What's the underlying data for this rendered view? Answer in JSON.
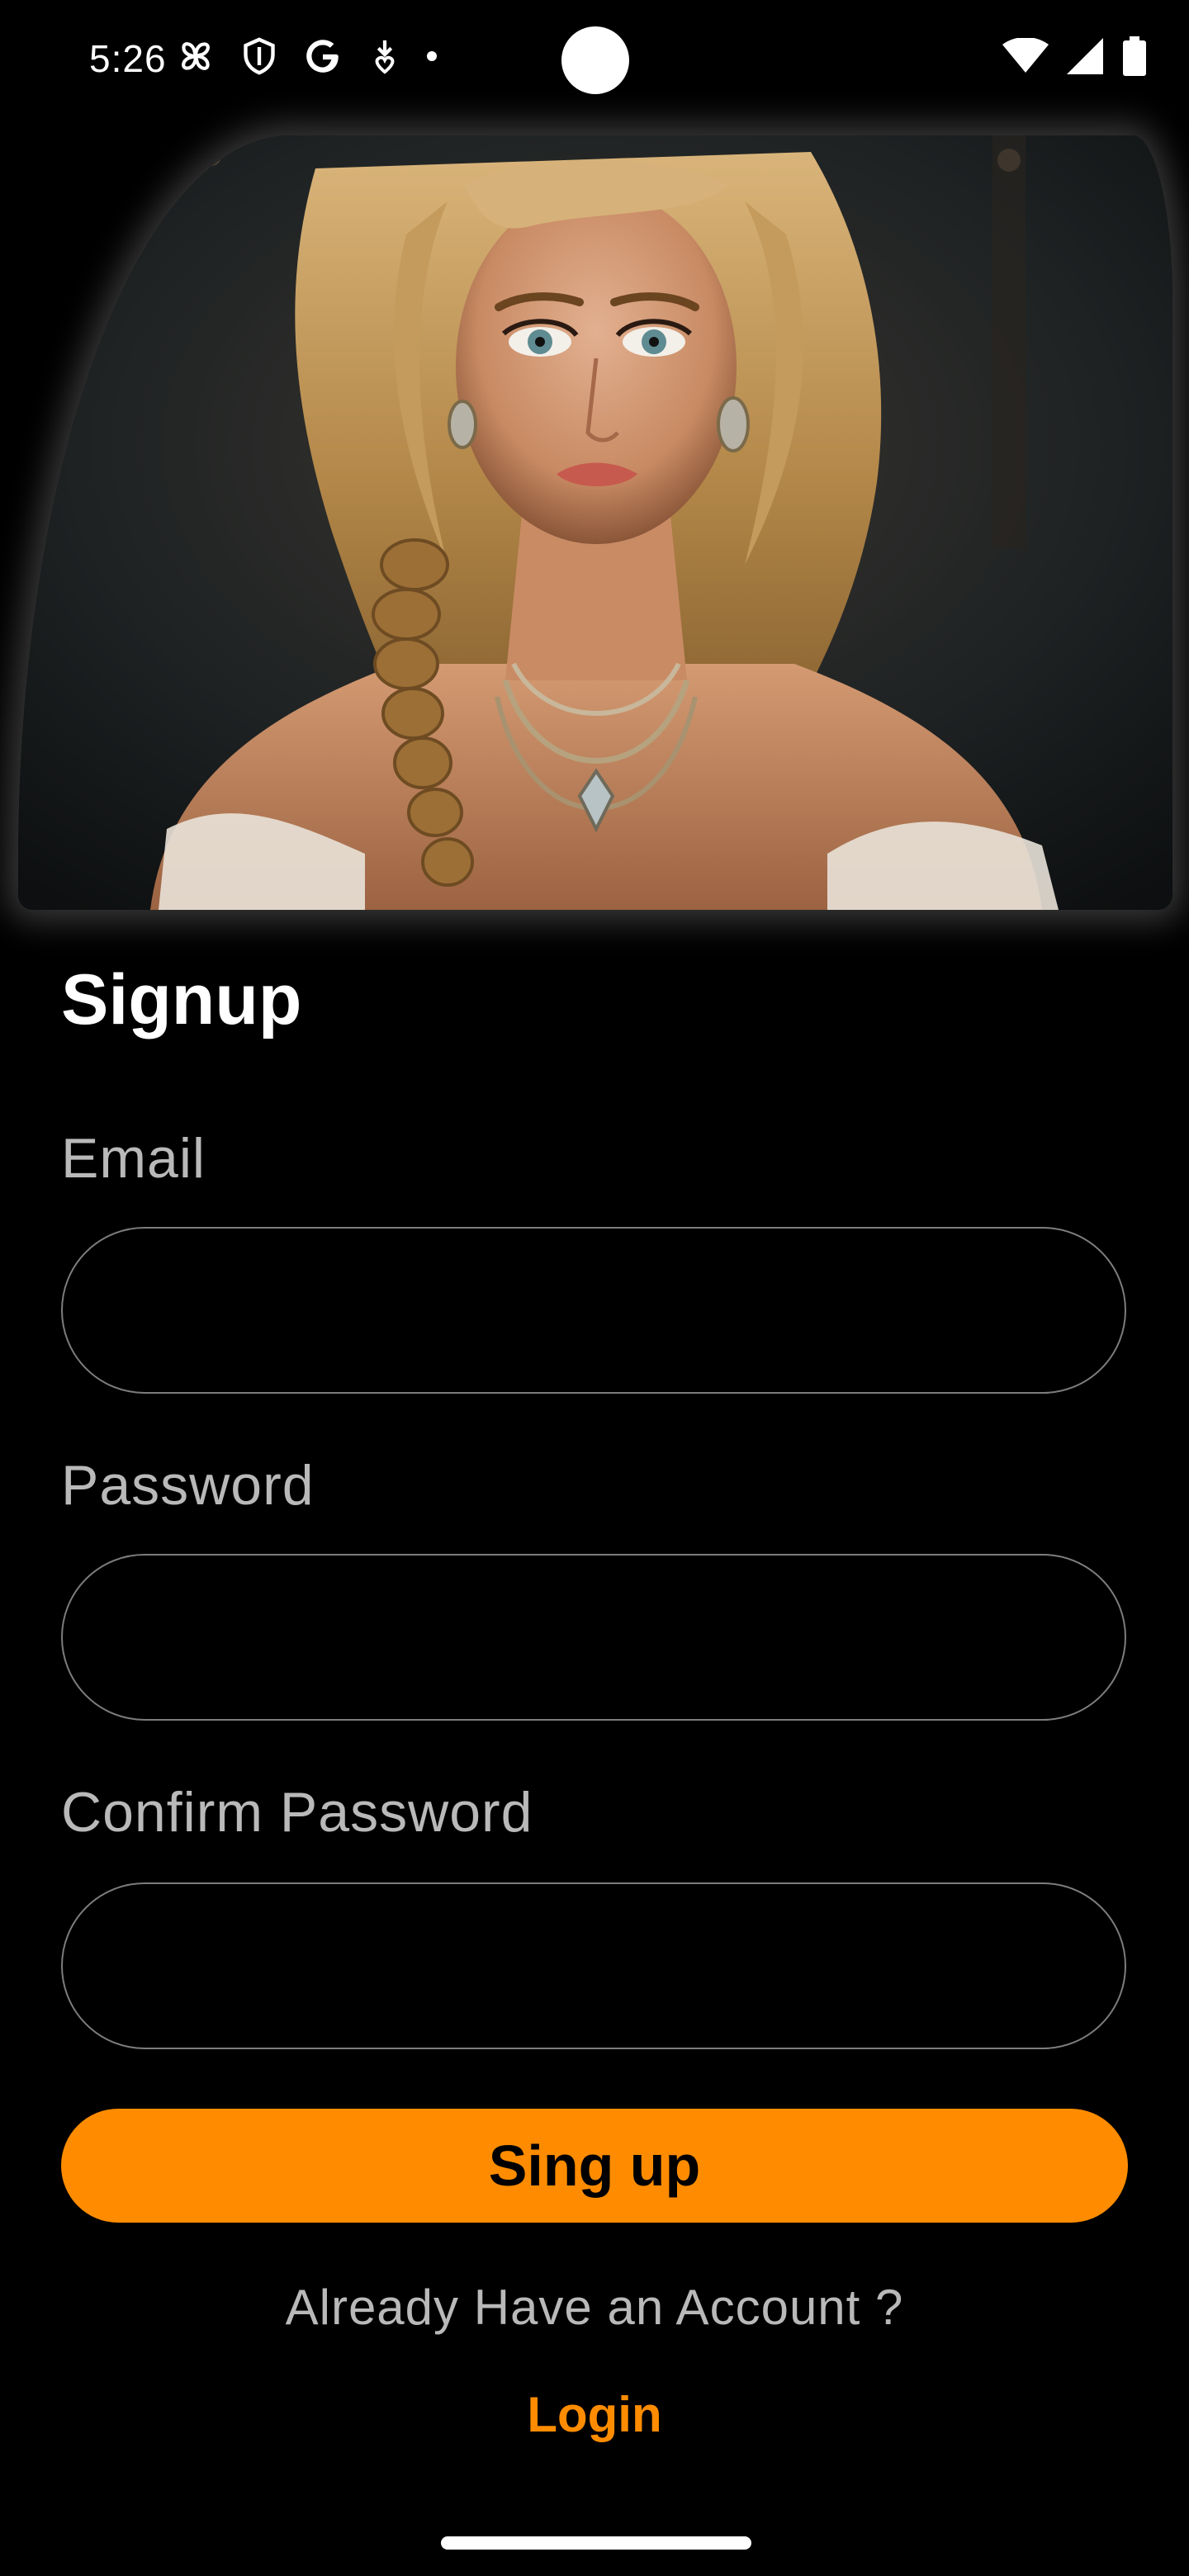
{
  "status_bar": {
    "time": "5:26",
    "left_icons": [
      "pinwheel-icon",
      "shield-icon",
      "google-icon",
      "download-heart-icon",
      "dot-icon"
    ],
    "right_icons": [
      "wifi-icon",
      "signal-icon",
      "battery-icon"
    ]
  },
  "hero": {
    "image": "portrait of a blonde woman with braided hair wearing layered necklaces"
  },
  "form": {
    "title": "Signup",
    "email_label": "Email",
    "email_value": "",
    "password_label": "Password",
    "password_value": "",
    "confirm_label": "Confirm Password",
    "confirm_value": "",
    "submit_label": "Sing up"
  },
  "footer": {
    "already_text": "Already Have an Account ?",
    "login_label": "Login"
  },
  "colors": {
    "background": "#000000",
    "accent": "#ff8c00",
    "label_gray": "#b9b9b9",
    "field_border": "#7d7d7d"
  }
}
